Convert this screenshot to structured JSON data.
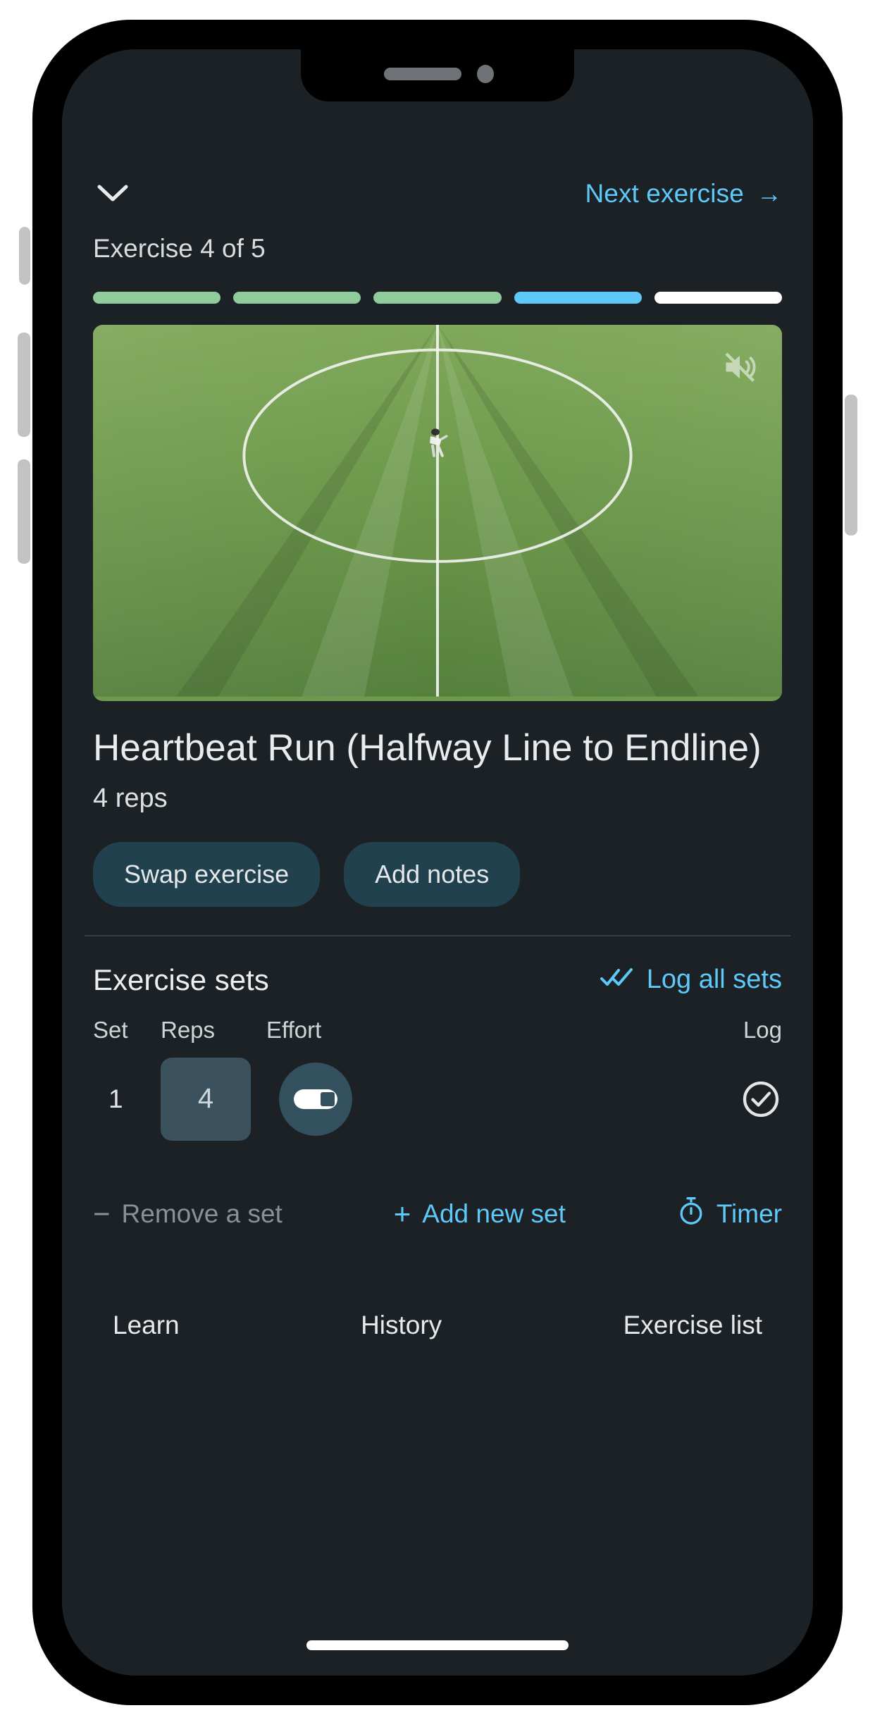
{
  "header": {
    "collapse_icon": "chevron-down-icon",
    "next_exercise_label": "Next exercise",
    "next_arrow": "→",
    "exercise_count": "Exercise 4 of 5"
  },
  "progress": {
    "segments": [
      {
        "state": "done"
      },
      {
        "state": "done"
      },
      {
        "state": "done"
      },
      {
        "state": "current"
      },
      {
        "state": "todo"
      }
    ],
    "colors": {
      "done": "#8fcb9b",
      "current": "#5ec8f8",
      "todo": "#ffffff"
    }
  },
  "video": {
    "mute_icon": "volume-off-icon",
    "alt": "aerial view of soccer pitch halfway line and center circle with player"
  },
  "exercise": {
    "title": "Heartbeat Run (Halfway Line to Endline)",
    "subtitle": "4 reps",
    "actions": [
      {
        "label": "Swap exercise"
      },
      {
        "label": "Add notes"
      }
    ]
  },
  "sets": {
    "section_title": "Exercise sets",
    "log_all_label": "Log all sets",
    "log_all_icon": "double-check-icon",
    "columns": [
      "Set",
      "Reps",
      "Effort",
      "Log"
    ],
    "rows": [
      {
        "set": "1",
        "reps": "4",
        "effort_icon": "slider-icon",
        "log_icon": "check-circle-icon"
      }
    ]
  },
  "set_actions": {
    "remove": {
      "label": "Remove a set",
      "symbol": "−",
      "enabled": false
    },
    "add": {
      "label": "Add new set",
      "symbol": "+",
      "enabled": true
    },
    "timer": {
      "label": "Timer",
      "icon": "stopwatch-icon",
      "enabled": true
    }
  },
  "bottom_nav": [
    {
      "label": "Learn"
    },
    {
      "label": "History"
    },
    {
      "label": "Exercise list"
    }
  ],
  "theme": {
    "background": "#1b2125",
    "accent": "#5ec8f8",
    "pill_background": "#22414f",
    "input_background": "#3b525e"
  }
}
